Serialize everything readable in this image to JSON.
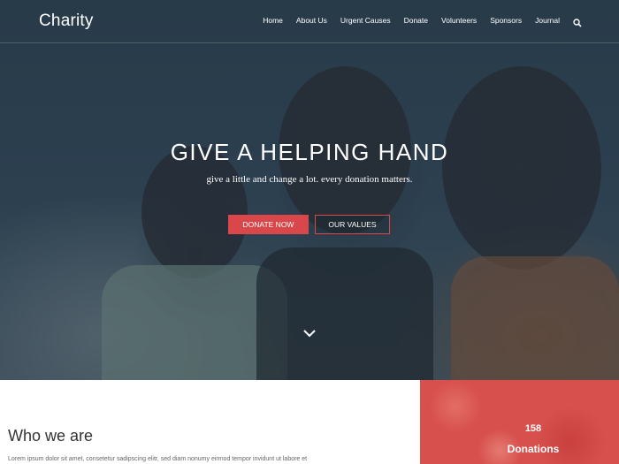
{
  "header": {
    "logo": "Charity",
    "nav": [
      "Home",
      "About Us",
      "Urgent Causes",
      "Donate",
      "Volunteers",
      "Sponsors",
      "Journal"
    ],
    "search_icon": "search-icon"
  },
  "hero": {
    "title": "GIVE A HELPING HAND",
    "subtitle": "give a little and change a lot. every donation matters.",
    "donate_button": "DONATE NOW",
    "values_button": "OUR VALUES",
    "scroll_icon": "chevron-down-icon"
  },
  "about": {
    "heading": "Who we are",
    "text": "Lorem ipsum dolor sit amet, consetetur sadipscing elitr, sed diam nonumy eirmod tempor invidunt ut labore et"
  },
  "stats": {
    "count": "158",
    "label": "Donations"
  },
  "colors": {
    "accent": "#d9474a",
    "hero_overlay": "#2f4250"
  }
}
